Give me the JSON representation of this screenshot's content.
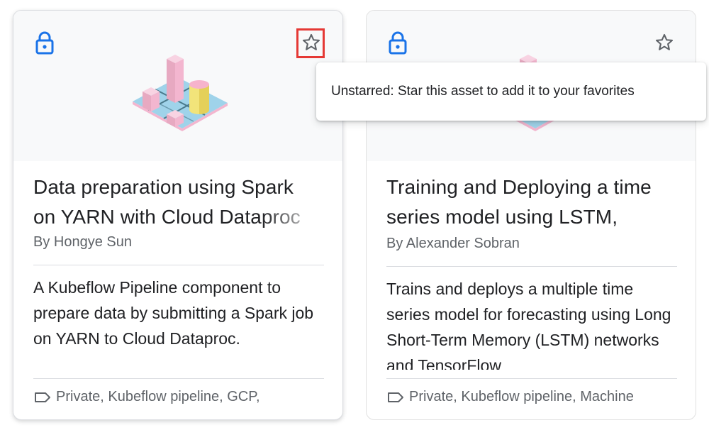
{
  "cards": [
    {
      "title_lines": [
        "Data preparation using Spark",
        "on YARN with Cloud Dataproc"
      ],
      "author": "By Hongye Sun",
      "description": "A Kubeflow Pipeline component to prepare data by submitting a Spark job on YARN to Cloud Dataproc.",
      "tags": "Private, Kubeflow pipeline, GCP,",
      "icons": [
        "lock-icon",
        "star-outline-icon",
        "tag-icon"
      ],
      "starred": false
    },
    {
      "title_lines": [
        "Training and Deploying a time",
        "series model using LSTM,"
      ],
      "author": "By Alexander Sobran",
      "description": "Trains and deploys a multiple time series model for forecasting using Long Short-Term Memory (LSTM) networks and TensorFlow",
      "tags": "Private, Kubeflow pipeline, Machine",
      "icons": [
        "lock-icon",
        "star-outline-icon",
        "tag-icon"
      ],
      "starred": false
    }
  ],
  "tooltip": {
    "text": "Unstarred: Star this asset to add it to your favorites"
  },
  "colors": {
    "lock_blue": "#1a73e8",
    "highlight_red": "#e53935",
    "banner_bg": "#f8f9fa"
  }
}
